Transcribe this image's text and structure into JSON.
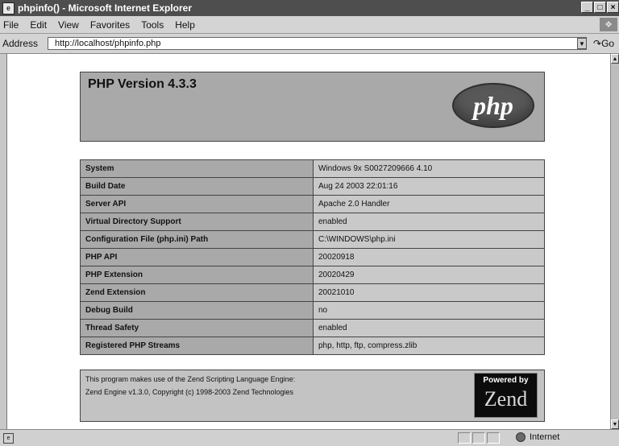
{
  "window": {
    "title": "phpinfo() - Microsoft Internet Explorer",
    "controls": [
      "_",
      "□",
      "×"
    ]
  },
  "menu": [
    "File",
    "Edit",
    "View",
    "Favorites",
    "Tools",
    "Help"
  ],
  "address": {
    "label": "Address",
    "url": "http://localhost/phpinfo.php",
    "go_label": "Go"
  },
  "page": {
    "version_title": "PHP Version 4.3.3",
    "php_logo_text": "php",
    "rows": [
      {
        "key": "System",
        "value": "Windows 9x S0027209666 4.10"
      },
      {
        "key": "Build Date",
        "value": "Aug 24 2003 22:01:16"
      },
      {
        "key": "Server API",
        "value": "Apache 2.0 Handler"
      },
      {
        "key": "Virtual Directory Support",
        "value": "enabled"
      },
      {
        "key": "Configuration File (php.ini) Path",
        "value": "C:\\WINDOWS\\php.ini"
      },
      {
        "key": "PHP API",
        "value": "20020918"
      },
      {
        "key": "PHP Extension",
        "value": "20020429"
      },
      {
        "key": "Zend Extension",
        "value": "20021010"
      },
      {
        "key": "Debug Build",
        "value": "no"
      },
      {
        "key": "Thread Safety",
        "value": "enabled"
      },
      {
        "key": "Registered PHP Streams",
        "value": "php, http, ftp, compress.zlib"
      }
    ],
    "zend_line1": "This program makes use of the Zend Scripting Language Engine:",
    "zend_line2": "Zend Engine v1.3.0, Copyright (c) 1998-2003 Zend Technologies",
    "zend_logo_top": "Powered by",
    "zend_logo_word": "Zend"
  },
  "status": {
    "zone": "Internet"
  }
}
